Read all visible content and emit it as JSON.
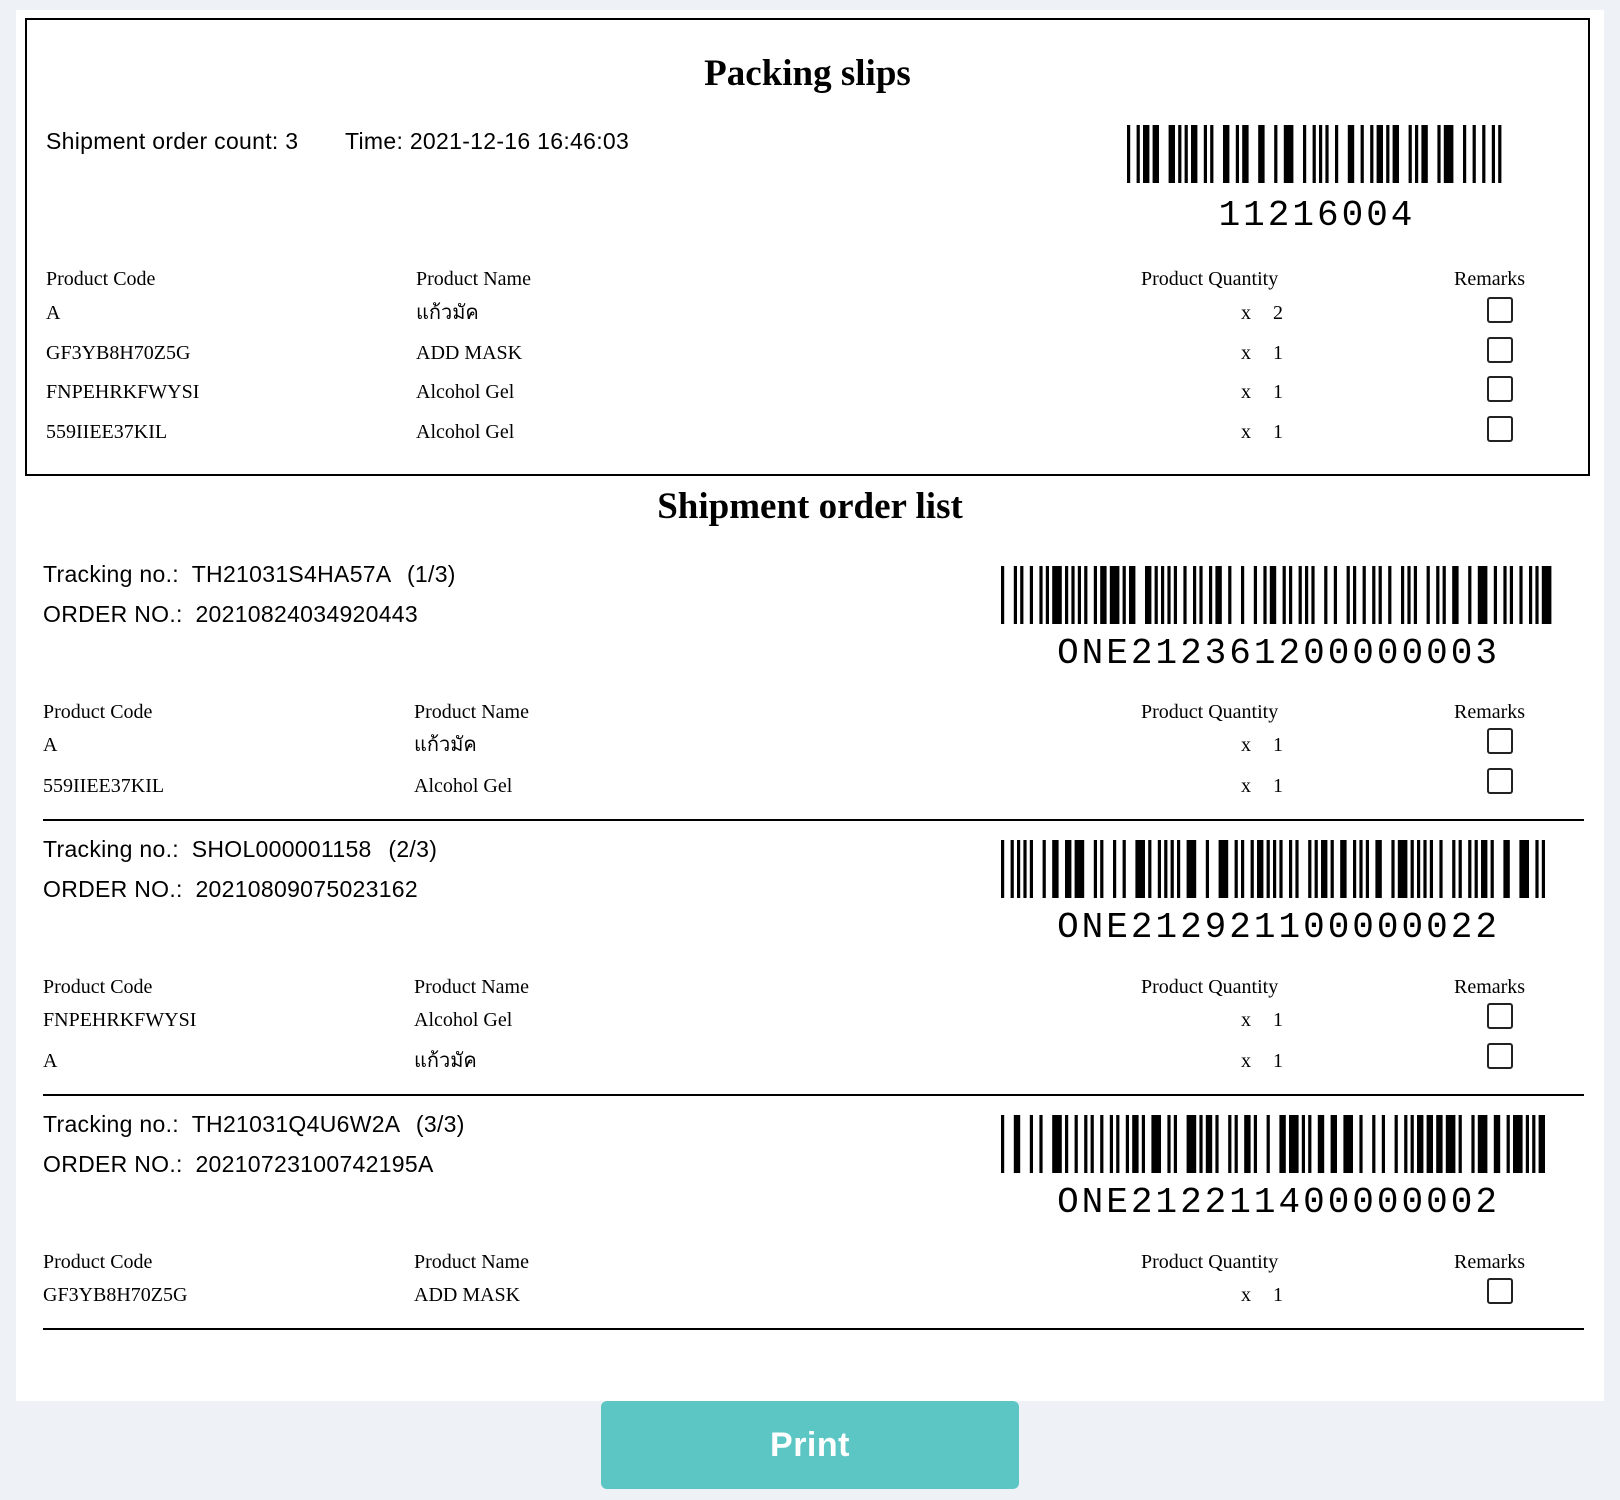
{
  "packing": {
    "title": "Packing slips",
    "count_label": "Shipment order count: 3",
    "time_label": "Time: 2021-12-16 16:46:03",
    "barcode_text": "11216004",
    "headers": {
      "code": "Product Code",
      "name": "Product Name",
      "qty": "Product Quantity",
      "remarks": "Remarks"
    },
    "items": [
      {
        "code": "A",
        "name": "แก้วมัค",
        "x": "x",
        "qty": "2"
      },
      {
        "code": "GF3YB8H70Z5G",
        "name": "ADD MASK",
        "x": "x",
        "qty": "1"
      },
      {
        "code": "FNPEHRKFWYSI",
        "name": "Alcohol Gel",
        "x": "x",
        "qty": "1"
      },
      {
        "code": "559IIEE37KIL",
        "name": "Alcohol Gel",
        "x": "x",
        "qty": "1"
      }
    ]
  },
  "shipments": {
    "title": "Shipment order list",
    "tracking_label": "Tracking no.:",
    "order_label": "ORDER NO.:",
    "orders": [
      {
        "tracking": "TH21031S4HA57A",
        "position": "(1/3)",
        "order_no": "20210824034920443",
        "barcode_text": "ONE212361200000003",
        "items": [
          {
            "code": "A",
            "name": "แก้วมัค",
            "x": "x",
            "qty": "1"
          },
          {
            "code": "559IIEE37KIL",
            "name": "Alcohol Gel",
            "x": "x",
            "qty": "1"
          }
        ]
      },
      {
        "tracking": "SHOL000001158",
        "position": "(2/3)",
        "order_no": "20210809075023162",
        "barcode_text": "ONE212921100000022",
        "items": [
          {
            "code": "FNPEHRKFWYSI",
            "name": "Alcohol Gel",
            "x": "x",
            "qty": "1"
          },
          {
            "code": "A",
            "name": "แก้วมัค",
            "x": "x",
            "qty": "1"
          }
        ]
      },
      {
        "tracking": "TH21031Q4U6W2A",
        "position": "(3/3)",
        "order_no": "20210723100742195A",
        "barcode_text": "ONE212211400000002",
        "items": [
          {
            "code": "GF3YB8H70Z5G",
            "name": "ADD MASK",
            "x": "x",
            "qty": "1"
          }
        ]
      }
    ]
  },
  "actions": {
    "print_label": "Print"
  }
}
